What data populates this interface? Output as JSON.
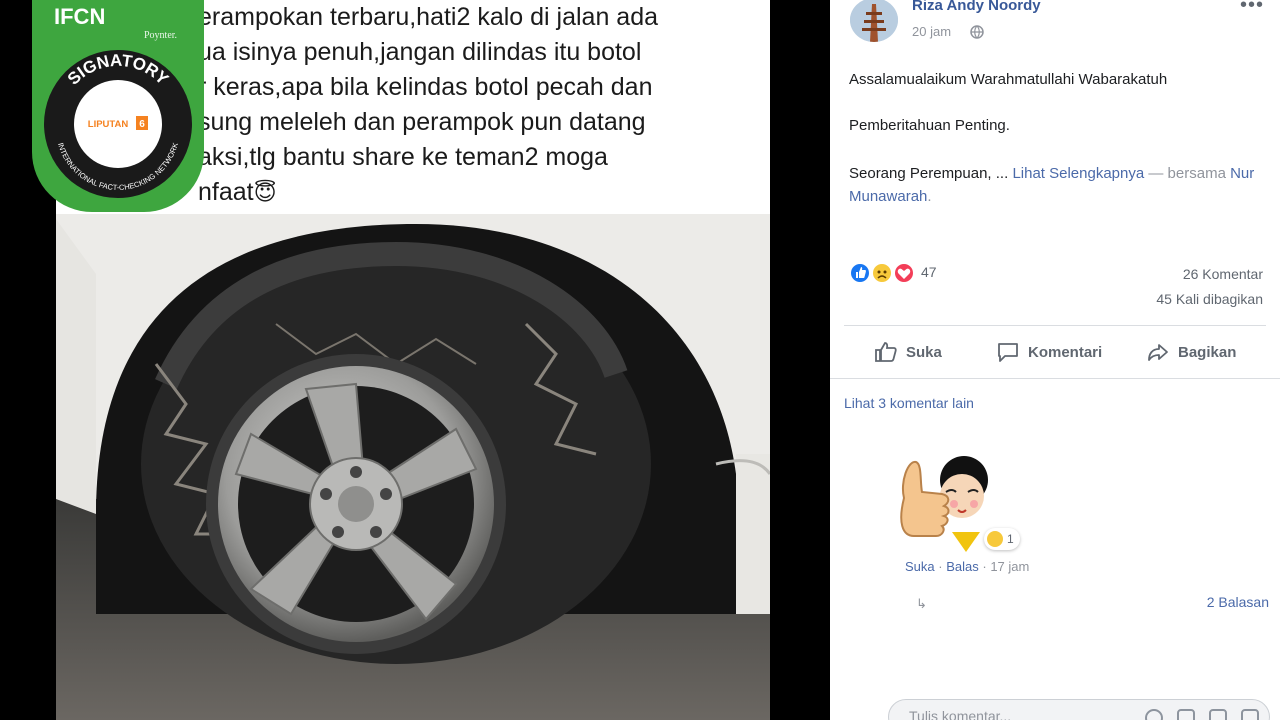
{
  "post_image": {
    "caption_lines": [
      "erampokan terbaru,hati2 kalo di jalan ada",
      "ua   isinya penuh,jangan dilindas itu botol",
      "r keras,apa bila kelindas botol pecah dan",
      "sung meleleh dan perampok pun datang",
      "aksi,tlg bantu share ke teman2 moga",
      "nfaat"
    ],
    "emoji": "😇"
  },
  "badge": {
    "ifcn": "IFCN",
    "poynter": "Poynter.",
    "signatory": "SIGNATORY",
    "network": "INTERNATIONAL FACT-CHECKING NETWORK",
    "member": "LIPUTAN6"
  },
  "fb_post": {
    "author": "Riza Andy Noordy",
    "time": "20 jam",
    "more_icon": "ellipsis-icon",
    "greeting": "Assalamualaikum Warahmatullahi Wabarakatuh",
    "heading": "Pemberitahuan Penting.",
    "teaser": "Seorang Perempuan, ...",
    "see_more": "Lihat Selengkapnya",
    "with_prefix": "— bersama",
    "tagged": "Nur Munawarah",
    "reaction_count": "47",
    "comments_count": "26 Komentar",
    "shares_count": "45 Kali dibagikan",
    "actions": {
      "like": "Suka",
      "comment": "Komentari",
      "share": "Bagikan"
    },
    "more_comments": "Lihat 3 komentar lain",
    "comment": {
      "reaction_count": "1",
      "like": "Suka",
      "reply": "Balas",
      "time": "17 jam",
      "replies": "2 Balasan"
    },
    "comment_placeholder": "Tulis komentar..."
  },
  "colors": {
    "fb_link": "#385898",
    "ifcn_green": "#3ea63f",
    "like_blue": "#1877f2",
    "love_red": "#f33e58",
    "liputan_orange": "#f58220"
  }
}
